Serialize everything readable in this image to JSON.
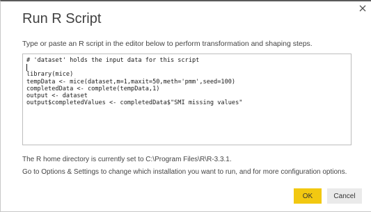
{
  "dialog": {
    "title": "Run R Script",
    "instructions": "Type or paste an R script in the editor below to perform transformation and shaping steps.",
    "close_icon": "close-icon"
  },
  "editor": {
    "lines": [
      "# 'dataset' holds the input data for this script",
      "",
      "library(mice)",
      "tempData <- mice(dataset,m=1,maxit=50,meth='pmm',seed=100)",
      "completedData <- complete(tempData,1)",
      "output <- dataset",
      "output$completedValues <- completedData$\"SMI missing values\""
    ]
  },
  "info": {
    "home_directory": "The R home directory is currently set to C:\\Program Files\\R\\R-3.3.1.",
    "options_hint": "Go to Options & Settings to change which installation you want to run, and for more configuration options."
  },
  "buttons": {
    "ok_label": "OK",
    "cancel_label": "Cancel"
  },
  "colors": {
    "ok_button": "#F2C811",
    "cancel_button": "#EAEAEA",
    "title_text": "#404040"
  }
}
